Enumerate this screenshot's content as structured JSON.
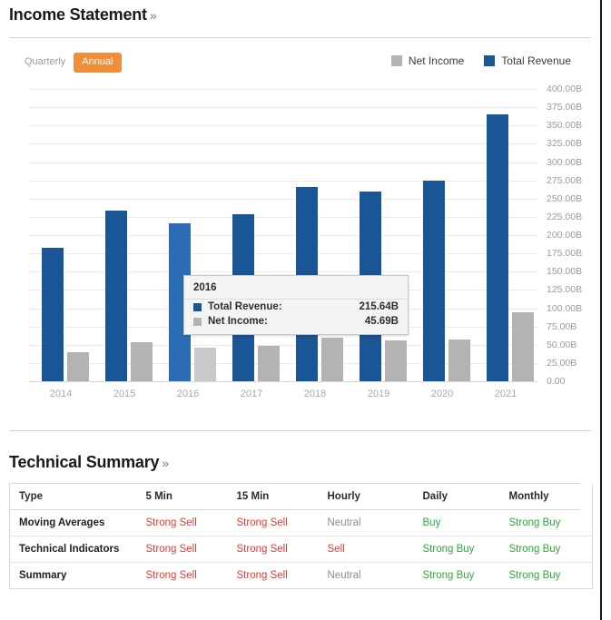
{
  "income_statement": {
    "title": "Income Statement",
    "chevron": "»",
    "toggle": {
      "quarterly": "Quarterly",
      "annual": "Annual",
      "active": "Annual"
    },
    "legend": [
      {
        "label": "Net Income",
        "color": "#b3b3b3",
        "icon": "legend-swatch"
      },
      {
        "label": "Total Revenue",
        "color": "#1a5596",
        "icon": "legend-swatch"
      }
    ],
    "tooltip": {
      "title": "2016",
      "rows": [
        {
          "label": "Total Revenue:",
          "value": "215.64B",
          "color": "#1a5596"
        },
        {
          "label": "Net Income:",
          "value": "45.69B",
          "color": "#b3b3b3"
        }
      ]
    }
  },
  "chart_data": {
    "type": "bar",
    "title": "Income Statement",
    "xlabel": "",
    "ylabel": "",
    "ylim": [
      0,
      400
    ],
    "grid": true,
    "legend_position": "top-right",
    "categories": [
      "2014",
      "2015",
      "2016",
      "2017",
      "2018",
      "2019",
      "2020",
      "2021"
    ],
    "tick_labels": [
      "0.00",
      "25.00B",
      "50.00B",
      "75.00B",
      "100.00B",
      "125.00B",
      "150.00B",
      "175.00B",
      "200.00B",
      "225.00B",
      "250.00B",
      "275.00B",
      "300.00B",
      "325.00B",
      "350.00B",
      "375.00B",
      "400.00B"
    ],
    "highlighted_category": "2016",
    "series": [
      {
        "name": "Total Revenue",
        "color": "#1a5596",
        "unit": "B",
        "values": [
          182.8,
          233.7,
          215.64,
          229.2,
          265.6,
          260.2,
          274.5,
          365.8
        ]
      },
      {
        "name": "Net Income",
        "color": "#b3b3b3",
        "unit": "B",
        "values": [
          39.5,
          53.4,
          45.69,
          48.4,
          59.5,
          55.3,
          57.4,
          94.7
        ]
      }
    ]
  },
  "technical_summary": {
    "title": "Technical Summary",
    "chevron": "»",
    "columns": [
      "Type",
      "5 Min",
      "15 Min",
      "Hourly",
      "Daily",
      "Monthly"
    ],
    "rows": [
      {
        "type": "Moving Averages",
        "cells": [
          {
            "text": "Strong Sell",
            "tone": "sell"
          },
          {
            "text": "Strong Sell",
            "tone": "sell"
          },
          {
            "text": "Neutral",
            "tone": "neutral"
          },
          {
            "text": "Buy",
            "tone": "buy"
          },
          {
            "text": "Strong Buy",
            "tone": "buy"
          }
        ]
      },
      {
        "type": "Technical Indicators",
        "cells": [
          {
            "text": "Strong Sell",
            "tone": "sell"
          },
          {
            "text": "Strong Sell",
            "tone": "sell"
          },
          {
            "text": "Sell",
            "tone": "sell"
          },
          {
            "text": "Strong Buy",
            "tone": "buy"
          },
          {
            "text": "Strong Buy",
            "tone": "buy"
          }
        ]
      },
      {
        "type": "Summary",
        "cells": [
          {
            "text": "Strong Sell",
            "tone": "sell"
          },
          {
            "text": "Strong Sell",
            "tone": "sell"
          },
          {
            "text": "Neutral",
            "tone": "neutral"
          },
          {
            "text": "Strong Buy",
            "tone": "buy"
          },
          {
            "text": "Strong Buy",
            "tone": "buy"
          }
        ]
      }
    ],
    "colors": {
      "sell": "#e03a35",
      "buy": "#2fa83c",
      "neutral": "#8c8c8c"
    }
  }
}
